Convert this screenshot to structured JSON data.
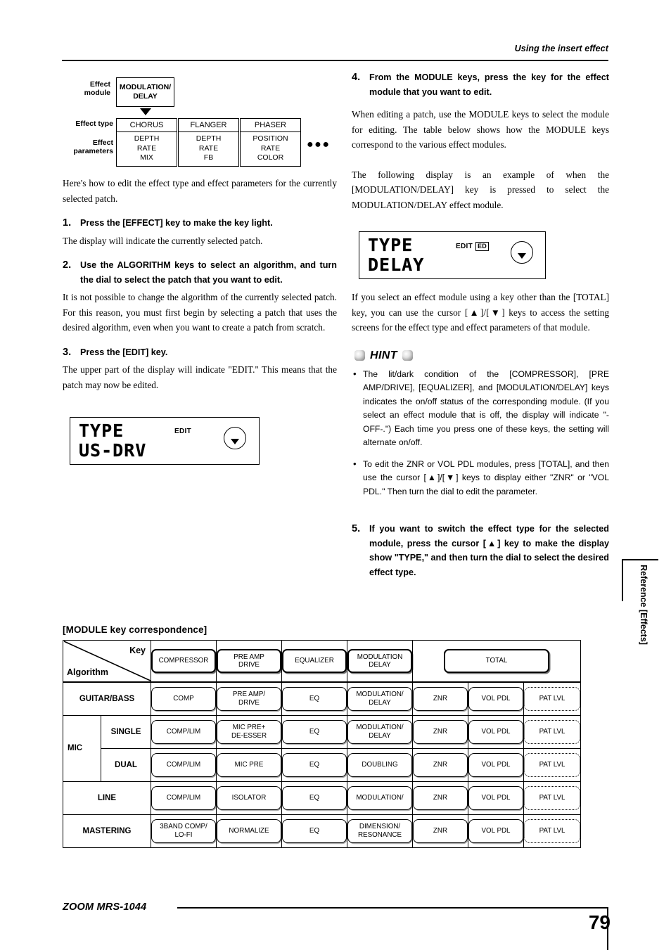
{
  "header": {
    "title": "Using the insert effect"
  },
  "diagram": {
    "labels": {
      "module": "Effect\nmodule",
      "module_l1": "Effect",
      "module_l2": "module",
      "effect_type": "Effect type",
      "params_l1": "Effect",
      "params_l2": "parameters"
    },
    "module_box": {
      "line1": "MODULATION/",
      "line2": "DELAY"
    },
    "types": [
      {
        "name": "CHORUS",
        "params": [
          "DEPTH",
          "RATE",
          "MIX"
        ]
      },
      {
        "name": "FLANGER",
        "params": [
          "DEPTH",
          "RATE",
          "FB"
        ]
      },
      {
        "name": "PHASER",
        "params": [
          "POSITION",
          "RATE",
          "COLOR"
        ]
      }
    ],
    "more": "●●●"
  },
  "left_column": {
    "intro": "Here's how to edit the effect type and effect parameters for the currently selected patch.",
    "steps": [
      {
        "num": "1.",
        "title": "Press the [EFFECT] key to make the key light.",
        "body": "The display will indicate the currently selected patch."
      },
      {
        "num": "2.",
        "title": "Use the ALGORITHM keys to select an algorithm, and turn the dial to select the patch that you want to edit.",
        "body": "It is not possible to change the algorithm of the currently selected patch. For this reason, you must first begin by selecting a patch that uses the desired algorithm, even when you want to create a patch from scratch."
      },
      {
        "num": "3.",
        "title": "Press the [EDIT] key.",
        "body": "The upper part of the display will indicate \"EDIT.\" This means that the patch may now be edited."
      }
    ],
    "lcd": {
      "line1": "TYPE",
      "line2": "US-DRV",
      "edit_label": "EDIT",
      "badge": "",
      "knob_icon": "triangle-down-icon"
    }
  },
  "right_column": {
    "step4": {
      "num": "4.",
      "title": "From the MODULE keys, press the key for the effect module that you want to edit.",
      "body1": "When editing a patch, use the MODULE keys to select the module for editing. The table below shows how the MODULE keys correspond to the various effect modules.",
      "body2": "The following display is an example of when the [MODULATION/DELAY] key is pressed to select the MODULATION/DELAY effect module."
    },
    "lcd": {
      "line1": "TYPE",
      "line2": "DELAY",
      "edit_label": "EDIT",
      "badge": "ED",
      "knob_icon": "triangle-down-icon"
    },
    "after_lcd": "If you select an effect module using a key other than the [TOTAL] key, you can use the cursor [▲]/[▼] keys to access the setting screens for the effect type and effect parameters of that module.",
    "hint": {
      "title": "HINT",
      "items": [
        "The lit/dark condition of the [COMPRESSOR], [PRE AMP/DRIVE], [EQUALIZER], and [MODULATION/DELAY] keys indicates the on/off status of the corresponding module. (If you select an effect module that is off, the display will indicate \"-OFF-.\") Each time you press one of these keys, the setting will alternate on/off.",
        "To edit the ZNR or VOL PDL modules, press [TOTAL], and then use the cursor [▲]/[▼] keys to display either \"ZNR\" or \"VOL PDL.\" Then turn the dial to edit the parameter."
      ]
    },
    "step5": {
      "num": "5.",
      "title": "If you want to switch the effect type for the selected module, press the cursor [▲] key to make the display show \"TYPE,\" and then turn the dial to select the desired effect type."
    }
  },
  "side_tab": {
    "label": "Reference [Effects]"
  },
  "table": {
    "caption": "[MODULE key correspondence]",
    "corner": {
      "key_label": "Key",
      "algorithm_label": "Algorithm"
    },
    "key_headers": [
      {
        "l1": "COMPRESSOR",
        "l2": ""
      },
      {
        "l1": "PRE AMP",
        "l2": "DRIVE"
      },
      {
        "l1": "EQUALIZER",
        "l2": ""
      },
      {
        "l1": "MODULATION",
        "l2": "DELAY"
      },
      {
        "l1": "TOTAL",
        "l2": ""
      }
    ],
    "rows": [
      {
        "group": "",
        "label": "GUITAR/BASS",
        "sub": "",
        "cells": [
          {
            "l1": "COMP",
            "l2": ""
          },
          {
            "l1": "PRE AMP/",
            "l2": "DRIVE"
          },
          {
            "l1": "EQ",
            "l2": ""
          },
          {
            "l1": "MODULATION/",
            "l2": "DELAY"
          },
          {
            "l1": "ZNR",
            "l2": ""
          },
          {
            "l1": "VOL PDL",
            "l2": ""
          },
          {
            "l1": "PAT LVL",
            "l2": "",
            "dotted": true
          }
        ]
      },
      {
        "group": "MIC",
        "label": "",
        "sub": "SINGLE",
        "cells": [
          {
            "l1": "COMP/LIM",
            "l2": ""
          },
          {
            "l1": "MIC PRE+",
            "l2": "DE-ESSER"
          },
          {
            "l1": "EQ",
            "l2": ""
          },
          {
            "l1": "MODULATION/",
            "l2": "DELAY"
          },
          {
            "l1": "ZNR",
            "l2": ""
          },
          {
            "l1": "VOL PDL",
            "l2": ""
          },
          {
            "l1": "PAT LVL",
            "l2": "",
            "dotted": true
          }
        ]
      },
      {
        "group": "",
        "label": "",
        "sub": "DUAL",
        "cells": [
          {
            "l1": "COMP/LIM",
            "l2": ""
          },
          {
            "l1": "MIC PRE",
            "l2": ""
          },
          {
            "l1": "EQ",
            "l2": ""
          },
          {
            "l1": "DOUBLING",
            "l2": ""
          },
          {
            "l1": "ZNR",
            "l2": ""
          },
          {
            "l1": "VOL PDL",
            "l2": ""
          },
          {
            "l1": "PAT LVL",
            "l2": "",
            "dotted": true
          }
        ]
      },
      {
        "group": "",
        "label": "LINE",
        "sub": "",
        "cells": [
          {
            "l1": "COMP/LIM",
            "l2": ""
          },
          {
            "l1": "ISOLATOR",
            "l2": ""
          },
          {
            "l1": "EQ",
            "l2": ""
          },
          {
            "l1": "MODULATION/",
            "l2": ""
          },
          {
            "l1": "ZNR",
            "l2": ""
          },
          {
            "l1": "VOL PDL",
            "l2": ""
          },
          {
            "l1": "PAT LVL",
            "l2": "",
            "dotted": true
          }
        ]
      },
      {
        "group": "",
        "label": "MASTERING",
        "sub": "",
        "cells": [
          {
            "l1": "3BAND COMP/",
            "l2": "LO-FI"
          },
          {
            "l1": "NORMALIZE",
            "l2": ""
          },
          {
            "l1": "EQ",
            "l2": ""
          },
          {
            "l1": "DIMENSION/",
            "l2": "RESONANCE"
          },
          {
            "l1": "ZNR",
            "l2": ""
          },
          {
            "l1": "VOL PDL",
            "l2": ""
          },
          {
            "l1": "PAT LVL",
            "l2": "",
            "dotted": true
          }
        ]
      }
    ]
  },
  "footer": {
    "brand": "ZOOM MRS-1044",
    "page": "79"
  }
}
